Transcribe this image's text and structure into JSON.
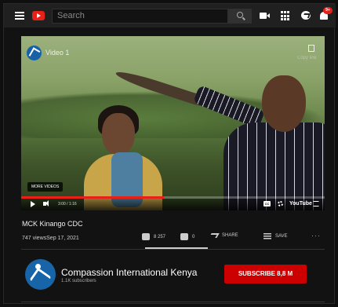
{
  "header": {
    "search_placeholder": "Search",
    "notification_count": "9+",
    "icons": [
      "menu-icon",
      "youtube-logo-icon",
      "search-icon",
      "create-video-icon",
      "apps-icon",
      "messages-icon",
      "notifications-icon"
    ]
  },
  "player": {
    "video_title": "Video 1",
    "copy_link_label": "Copy link",
    "more_videos_label": "MORE VIDEOS",
    "time": "3:00 / 1:16",
    "watermark": "YouTube",
    "progress": 0.47,
    "accent": "#e62117"
  },
  "video": {
    "title": "MCK Kinango CDC",
    "views_date": "747 viewsSep 17, 2021",
    "likes": "8 257",
    "dislikes": "0",
    "share_label": "SHARE",
    "save_label": "SAVE",
    "more_label": "···",
    "like_ratio": 1.0
  },
  "channel": {
    "name": "Compassion International Kenya",
    "subscribers": "1.1K subscribers",
    "subscribe_label": "SUBSCRIBE  8,8 M",
    "subscribe_color": "#cc0000"
  }
}
